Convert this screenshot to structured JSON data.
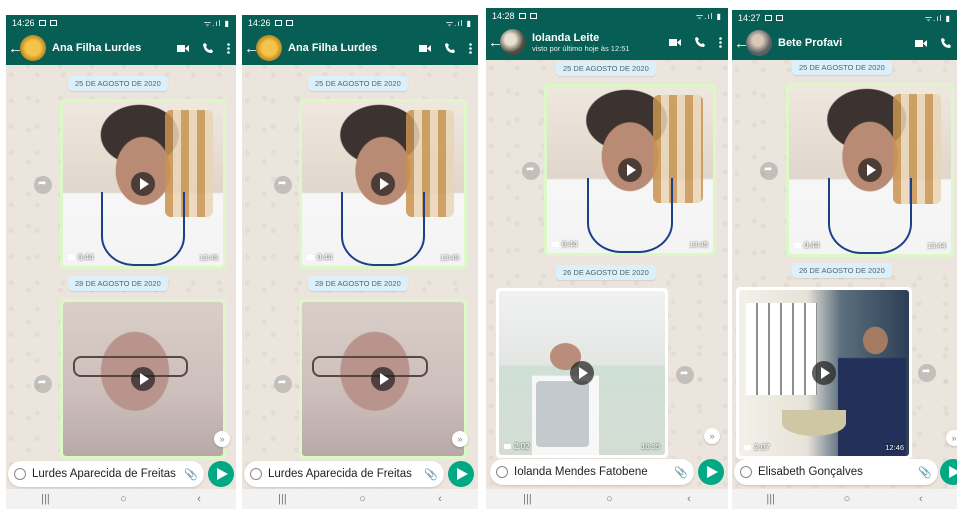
{
  "status_bar": {
    "right": "ᯤ.ıl ▮"
  },
  "phones": [
    {
      "time": "14:26",
      "contact": "Ana Filha Lurdes",
      "subtitle": "",
      "date1": "25 DE AGOSTO DE 2020",
      "video1": {
        "duration": "0:44",
        "time": "13:45"
      },
      "date2": "28 DE AGOSTO DE 2020",
      "video2": {
        "duration": "",
        "time": ""
      },
      "input": "Lurdes Aparecida de Freitas"
    },
    {
      "time": "14:26",
      "contact": "Ana Filha Lurdes",
      "subtitle": "",
      "date1": "25 DE AGOSTO DE 2020",
      "video1": {
        "duration": "0:44",
        "time": "13:45"
      },
      "date2": "28 DE AGOSTO DE 2020",
      "video2": {
        "duration": "",
        "time": ""
      },
      "input": "Lurdes Aparecida de Freitas"
    },
    {
      "time": "14:28",
      "contact": "Iolanda Leite",
      "subtitle": "visto por último hoje às 12:51",
      "date1": "25 DE AGOSTO DE 2020",
      "video1": {
        "duration": "0:44",
        "time": "13:45"
      },
      "date2": "26 DE AGOSTO DE 2020",
      "video2": {
        "duration": "2:02",
        "time": "10:35"
      },
      "input": "Iolanda Mendes Fatobene"
    },
    {
      "time": "14:27",
      "contact": "Bete Profavi",
      "subtitle": "",
      "date1": "25 DE AGOSTO DE 2020",
      "video1": {
        "duration": "0:44",
        "time": "13:44"
      },
      "date2": "26 DE AGOSTO DE 2020",
      "video2": {
        "duration": "2:07",
        "time": "12:46"
      },
      "input": "Elisabeth Gonçalves"
    }
  ],
  "icons": [
    "back-arrow-icon",
    "video-call-icon",
    "phone-icon",
    "more-vert-icon",
    "play-icon",
    "share-icon",
    "scroll-down-icon",
    "emoji-icon",
    "attach-icon",
    "send-icon",
    "recents-icon",
    "home-icon",
    "nav-back-icon"
  ],
  "colors": {
    "header": "#075e54",
    "bubble": "#dcf8c6",
    "chip": "#dcf0fb",
    "send": "#00a884",
    "chat_bg": "#ece5dd"
  },
  "navbar": {
    "recents": "|||",
    "home": "○",
    "back": "‹"
  }
}
